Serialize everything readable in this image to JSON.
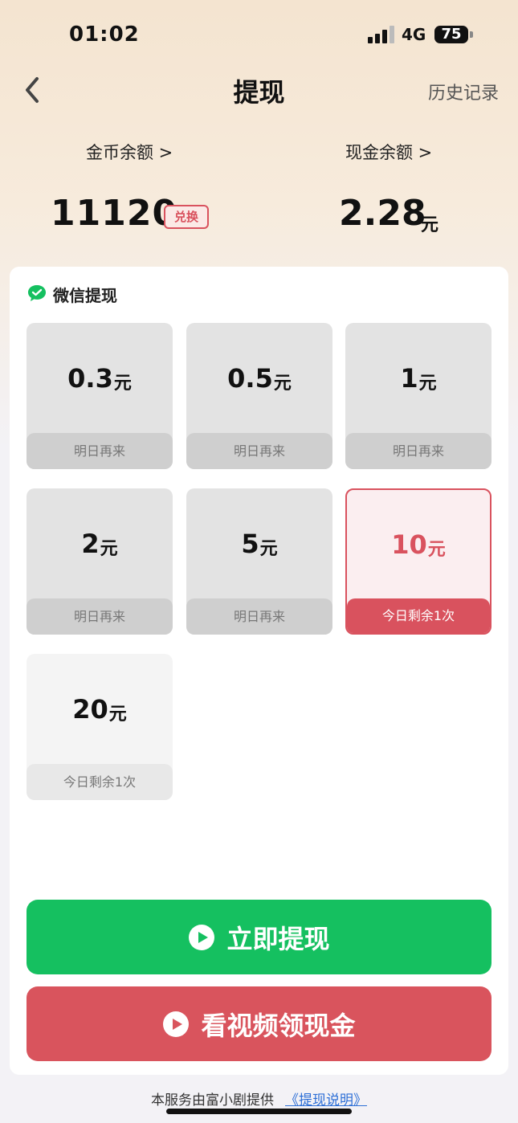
{
  "status_bar": {
    "time": "01:02",
    "network": "4G",
    "battery": "75"
  },
  "nav": {
    "title": "提现",
    "history": "历史记录"
  },
  "balances": {
    "coin_label": "金币余额 >",
    "coin_value": "11120",
    "exchange_label": "兑换",
    "cash_label": "现金余额 >",
    "cash_value": "2.28",
    "cash_unit": "元"
  },
  "wechat": {
    "title": "微信提现",
    "options": [
      {
        "amount": "0.3",
        "unit": "元",
        "note": "明日再来"
      },
      {
        "amount": "0.5",
        "unit": "元",
        "note": "明日再来"
      },
      {
        "amount": "1",
        "unit": "元",
        "note": "明日再来"
      },
      {
        "amount": "2",
        "unit": "元",
        "note": "明日再来"
      },
      {
        "amount": "5",
        "unit": "元",
        "note": "明日再来"
      },
      {
        "amount": "10",
        "unit": "元",
        "note": "今日剩余1次"
      },
      {
        "amount": "20",
        "unit": "元",
        "note": "今日剩余1次"
      }
    ]
  },
  "buttons": {
    "withdraw": "立即提现",
    "watch_video": "看视频领现金"
  },
  "footer": {
    "text": "本服务由富小剧提供",
    "link": "《提现说明》"
  },
  "colors": {
    "accent_red": "#d9525e",
    "green": "#15c060",
    "link_blue": "#2d6fd6"
  }
}
